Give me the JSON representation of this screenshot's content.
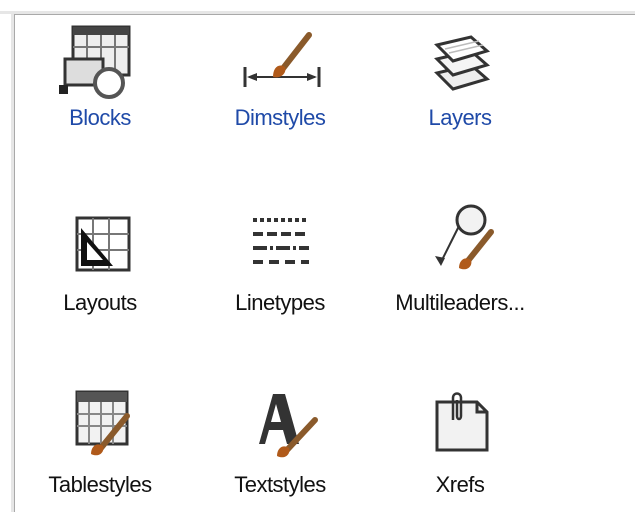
{
  "window": {
    "title": ""
  },
  "items": [
    {
      "label": "Blocks",
      "icon": "blocks-icon",
      "color": "#1f4aa8"
    },
    {
      "label": "Dimstyles",
      "icon": "dimstyles-icon",
      "color": "#1f4aa8"
    },
    {
      "label": "Layers",
      "icon": "layers-icon",
      "color": "#1f4aa8"
    },
    {
      "label": "Layouts",
      "icon": "layouts-icon",
      "color": "#111111"
    },
    {
      "label": "Linetypes",
      "icon": "linetypes-icon",
      "color": "#111111"
    },
    {
      "label": "Multileaders...",
      "icon": "multileaders-icon",
      "color": "#111111"
    },
    {
      "label": "Tablestyles",
      "icon": "tablestyles-icon",
      "color": "#111111"
    },
    {
      "label": "Textstyles",
      "icon": "textstyles-icon",
      "color": "#111111"
    },
    {
      "label": "Xrefs",
      "icon": "xrefs-icon",
      "color": "#111111"
    }
  ]
}
